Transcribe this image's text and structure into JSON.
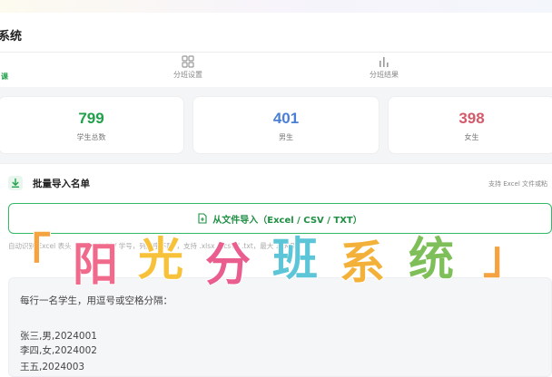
{
  "app": {
    "title": "系统"
  },
  "tabs": [
    {
      "label": "课",
      "active": true
    },
    {
      "label": "分班设置",
      "icon": "grid-icon"
    },
    {
      "label": "分班结果",
      "icon": "bar-chart-icon"
    }
  ],
  "stats": [
    {
      "value": "799",
      "label": "学生总数",
      "color": "#22a04b"
    },
    {
      "value": "401",
      "label": "男生",
      "color": "#4a7fd6"
    },
    {
      "value": "398",
      "label": "女生",
      "color": "#d45a6a"
    }
  ],
  "import": {
    "title": "批量导入名单",
    "hint": "支持 Excel 文件或粘",
    "button_label": "从文件导入（Excel / CSV / TXT）",
    "format_note": "自动识别 Excel 表头（姓名 / 性别 / 学号，列顺序不限），支持 .xlsx / .csv / .txt，最大 10MB"
  },
  "textarea": {
    "lines": [
      "每行一名学生，用逗号或空格分隔：",
      "张三,男,2024001",
      "李四,女,2024002",
      "王五,2024003"
    ]
  },
  "watermark": {
    "chars": [
      "「",
      "阳",
      "光",
      "分",
      "班",
      "系",
      "统",
      "」"
    ],
    "colors": [
      "#f4a340",
      "#f06a8c",
      "#f7c23a",
      "#e95e8f",
      "#5cc6d8",
      "#f3b13a",
      "#7fbf5a",
      "#f4a340"
    ]
  }
}
